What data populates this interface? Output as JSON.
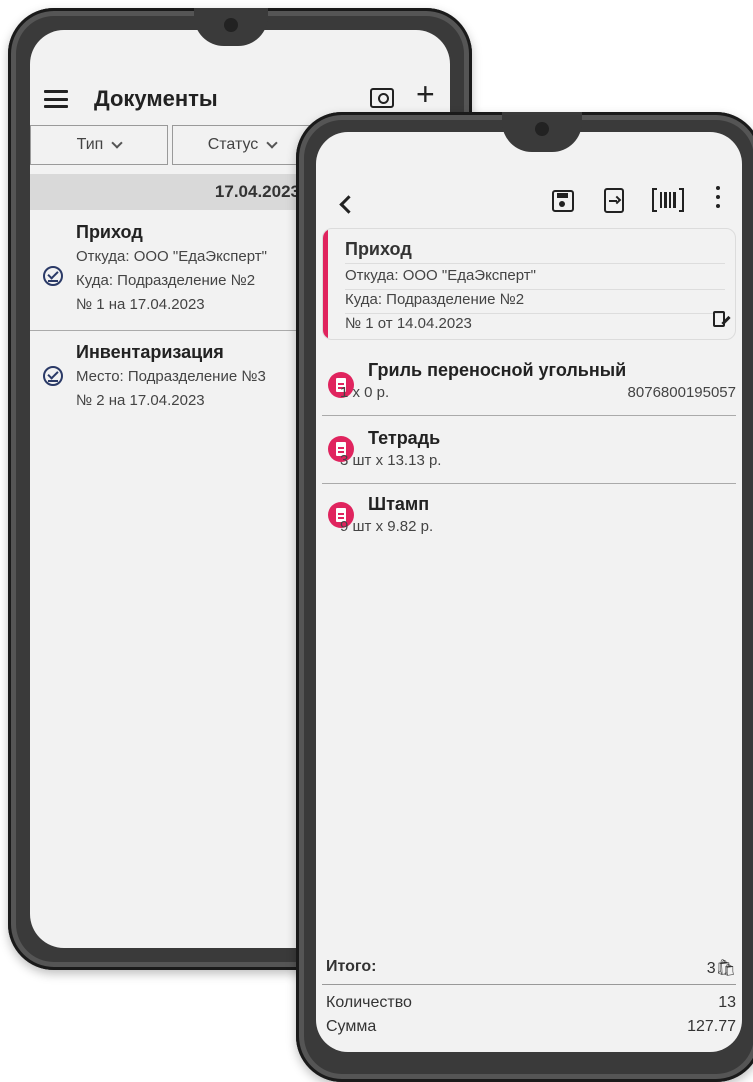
{
  "documents_screen": {
    "title": "Документы",
    "filters": [
      {
        "label": "Тип"
      },
      {
        "label": "Статус"
      }
    ],
    "date_group": "17.04.2023",
    "items": [
      {
        "title": "Приход",
        "lines": [
          "Откуда: ООО \"ЕдаЭксперт\"",
          "Куда: Подразделение №2",
          "№ 1 на 17.04.2023"
        ]
      },
      {
        "title": "Инвентаризация",
        "lines": [
          "Место: Подразделение №3",
          "№ 2 на 17.04.2023"
        ]
      }
    ]
  },
  "document_screen": {
    "header": {
      "title": "Приход",
      "from": "Откуда: ООО \"ЕдаЭксперт\"",
      "to": "Куда: Подразделение №2",
      "number": "№ 1 от 14.04.2023"
    },
    "positions": [
      {
        "name": "Гриль переносной угольный",
        "qty_price": "1  x 0 р.",
        "barcode": "8076800195057"
      },
      {
        "name": "Тетрадь",
        "qty_price": "3 шт x 13.13 р.",
        "barcode": ""
      },
      {
        "name": "Штамп",
        "qty_price": "9 шт x 9.82 р.",
        "barcode": ""
      }
    ],
    "totals": {
      "label": "Итого:",
      "count": "3🛍",
      "rows": [
        {
          "label": "Количество",
          "value": "13"
        },
        {
          "label": "Сумма",
          "value": "127.77"
        }
      ]
    }
  },
  "colors": {
    "accent": "#e0245e",
    "check": "#2b3a67",
    "frame": "#3a3a3a",
    "screen": "#f2f2f2"
  }
}
